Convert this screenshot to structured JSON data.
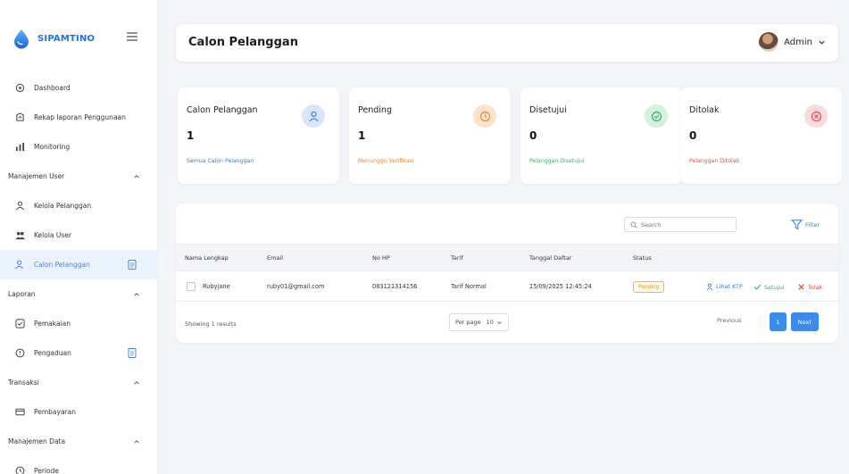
{
  "brand": {
    "name": "SIPAMTINO"
  },
  "sidebar": {
    "items": [
      {
        "label": "Dashboard"
      },
      {
        "label": "Rekap laporan Penggunaan"
      },
      {
        "label": "Monitoring"
      }
    ],
    "sections": [
      {
        "label": "Manajemen User",
        "items": [
          {
            "label": "Kelola Pelanggan"
          },
          {
            "label": "Kelola User"
          },
          {
            "label": "Calon Pelanggan"
          }
        ]
      },
      {
        "label": "Laporan",
        "items": [
          {
            "label": "Pemakaian"
          },
          {
            "label": "Pengaduan"
          }
        ]
      },
      {
        "label": "Transaksi",
        "items": [
          {
            "label": "Pembayaran"
          }
        ]
      },
      {
        "label": "Manajemen Data",
        "items": [
          {
            "label": "Periode"
          }
        ]
      }
    ]
  },
  "header": {
    "title": "Calon Pelanggan",
    "user": "Admin"
  },
  "cards": [
    {
      "title": "Calon Pelanggan",
      "value": "1",
      "sub": "Semua Calon Pelanggan",
      "color": "#2f7be0",
      "icon": "user-icon"
    },
    {
      "title": "Pending",
      "value": "1",
      "sub": "Menunggu Verifikasi",
      "color": "#e8852e",
      "icon": "clock-icon"
    },
    {
      "title": "Disetujui",
      "value": "0",
      "sub": "Pelanggan Disetujui",
      "color": "#2fb36a",
      "icon": "check-circle-icon"
    },
    {
      "title": "Ditolak",
      "value": "0",
      "sub": "Pelanggan Ditolak",
      "color": "#e84a4a",
      "icon": "x-circle-icon"
    }
  ],
  "table": {
    "search_placeholder": "Search",
    "filter_label": "Filter",
    "headers": [
      "Nama Lengkap",
      "Email",
      "No HP",
      "Tarif",
      "Tanggal Daftar",
      "Status"
    ],
    "rows": [
      {
        "name": "Rubyjane",
        "email": "ruby01@gmail.com",
        "phone": "083121314156",
        "tarif": "Tarif Normal",
        "date": "15/09/2025 12:45:24",
        "status": "Pending",
        "actions": {
          "ktp": "Lihat KTP",
          "approve": "Setujui",
          "reject": "Tolak"
        }
      }
    ],
    "footer": {
      "info": "Showing 1 results",
      "perpage_label": "Per page",
      "perpage_value": "10",
      "prev": "Previous",
      "page": "1",
      "next": "Next"
    }
  },
  "colors": {
    "accent": "#3b8bea",
    "pending": "#e0a020",
    "approve": "#2fb36a",
    "reject": "#e84a4a"
  }
}
